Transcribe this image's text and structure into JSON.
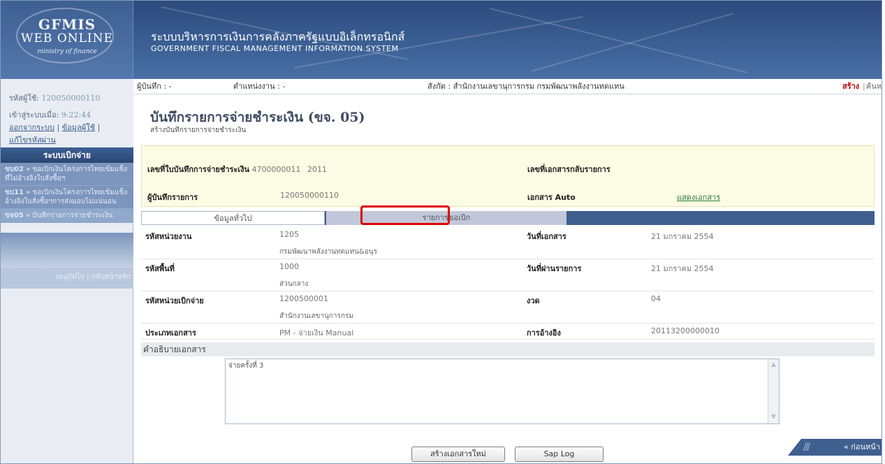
{
  "header": {
    "logo_line1": "GFMIS",
    "logo_line2": "WEB ONLINE",
    "logo_line3": "ministry of finance",
    "system_th": "ระบบบริหารการเงินการคลังภาครัฐแบบอิเล็กทรอนิกส์",
    "system_en": "GOVERNMENT FISCAL MANAGEMENT INFORMATION SYSTEM"
  },
  "user": {
    "id_label": "รหัสผู้ใช้:",
    "id_value": "120050000110",
    "login_label": "เข้าสู่ระบบเมื่อ:",
    "login_time": "9:22:44",
    "logout_link": "ออกจากระบบ",
    "profile_link": "ข้อมูลผู้ใช้",
    "change_pw_link": "แก้ไขรหัสผ่าน"
  },
  "menu": {
    "title": "ระบบเบิกจ่าย",
    "items": [
      {
        "code": "ขบ02",
        "label": "» ขอเบิกเงินโครงการไทยเข้มแข็งที่ไม่อ้างอิงใบสั่งซื้อฯ"
      },
      {
        "code": "ขบ11",
        "label": "» ขอเบิกเงินโครงการไทยเข้มแข็งอ้างอิงใบสั่งซื้อฯการส่งมอบไม่แน่นอน"
      },
      {
        "code": "ขจ05",
        "label": "» บันทึกรายการจ่ายชำระเงิน"
      }
    ],
    "footer_next": "เมนูถัดไป",
    "footer_home": "กลับหน้าหลัก"
  },
  "infobar": {
    "recorder": "ผู้บันทึก : -",
    "position": "ตำแหน่งงาน : -",
    "affiliation": "สังกัด : สำนักงานเลขานุการกรม กรมพัฒนาพลังงานทดแทน",
    "create": "สร้าง",
    "search": "ค้นหา"
  },
  "page": {
    "title": "บันทึกรายการจ่ายชำระเงิน (ขจ. 05)",
    "subtitle": "สร้างบันทึกรายการจ่ายชำระเงิน"
  },
  "doc": {
    "doc_no_label": "เลขที่ใบบันทึกการจ่ายชำระเงิน",
    "doc_no_value": "4700000011",
    "doc_year": "2011",
    "reverse_label": "เลขที่เอกสารกลับรายการ",
    "recorder_label": "ผู้บันทึกรายการ",
    "recorder_value": "120050000110",
    "auto_label": "เอกสาร Auto",
    "show_doc_link": "แสดงเอกสาร"
  },
  "tabs": {
    "general": "ข้อมูลทั่วไป",
    "items": "รายการขอเบิก"
  },
  "general": {
    "unit_code_label": "รหัสหน่วยงาน",
    "unit_code_value": "1205",
    "unit_code_name": "กรมพัฒนาพลังงานทดแทน&อนุร",
    "doc_date_label": "วันที่เอกสาร",
    "doc_date_value": "21 มกราคม 2554",
    "area_code_label": "รหัสพื้นที่",
    "area_code_value": "1000",
    "area_code_name": "ส่วนกลาง",
    "post_date_label": "วันที่ผ่านรายการ",
    "post_date_value": "21 มกราคม 2554",
    "disb_unit_label": "รหัสหน่วยเบิกจ่าย",
    "disb_unit_value": "1200500001",
    "disb_unit_name": "สำนักงานเลขานุการกรม",
    "period_label": "งวด",
    "period_value": "04",
    "doc_type_label": "ประเภทเอกสาร",
    "doc_type_value": "PM - จ่ายเงิน Manual",
    "reference_label": "การอ้างอิง",
    "reference_value": "20113200000010"
  },
  "description": {
    "title": "คำอธิบายเอกสาร",
    "value": "จ่ายครั้งที่ 3"
  },
  "nav": {
    "prev": "« ก่อนหน้า"
  },
  "buttons": {
    "new_doc": "สร้างเอกสารใหม่",
    "sap_log": "Sap Log"
  }
}
